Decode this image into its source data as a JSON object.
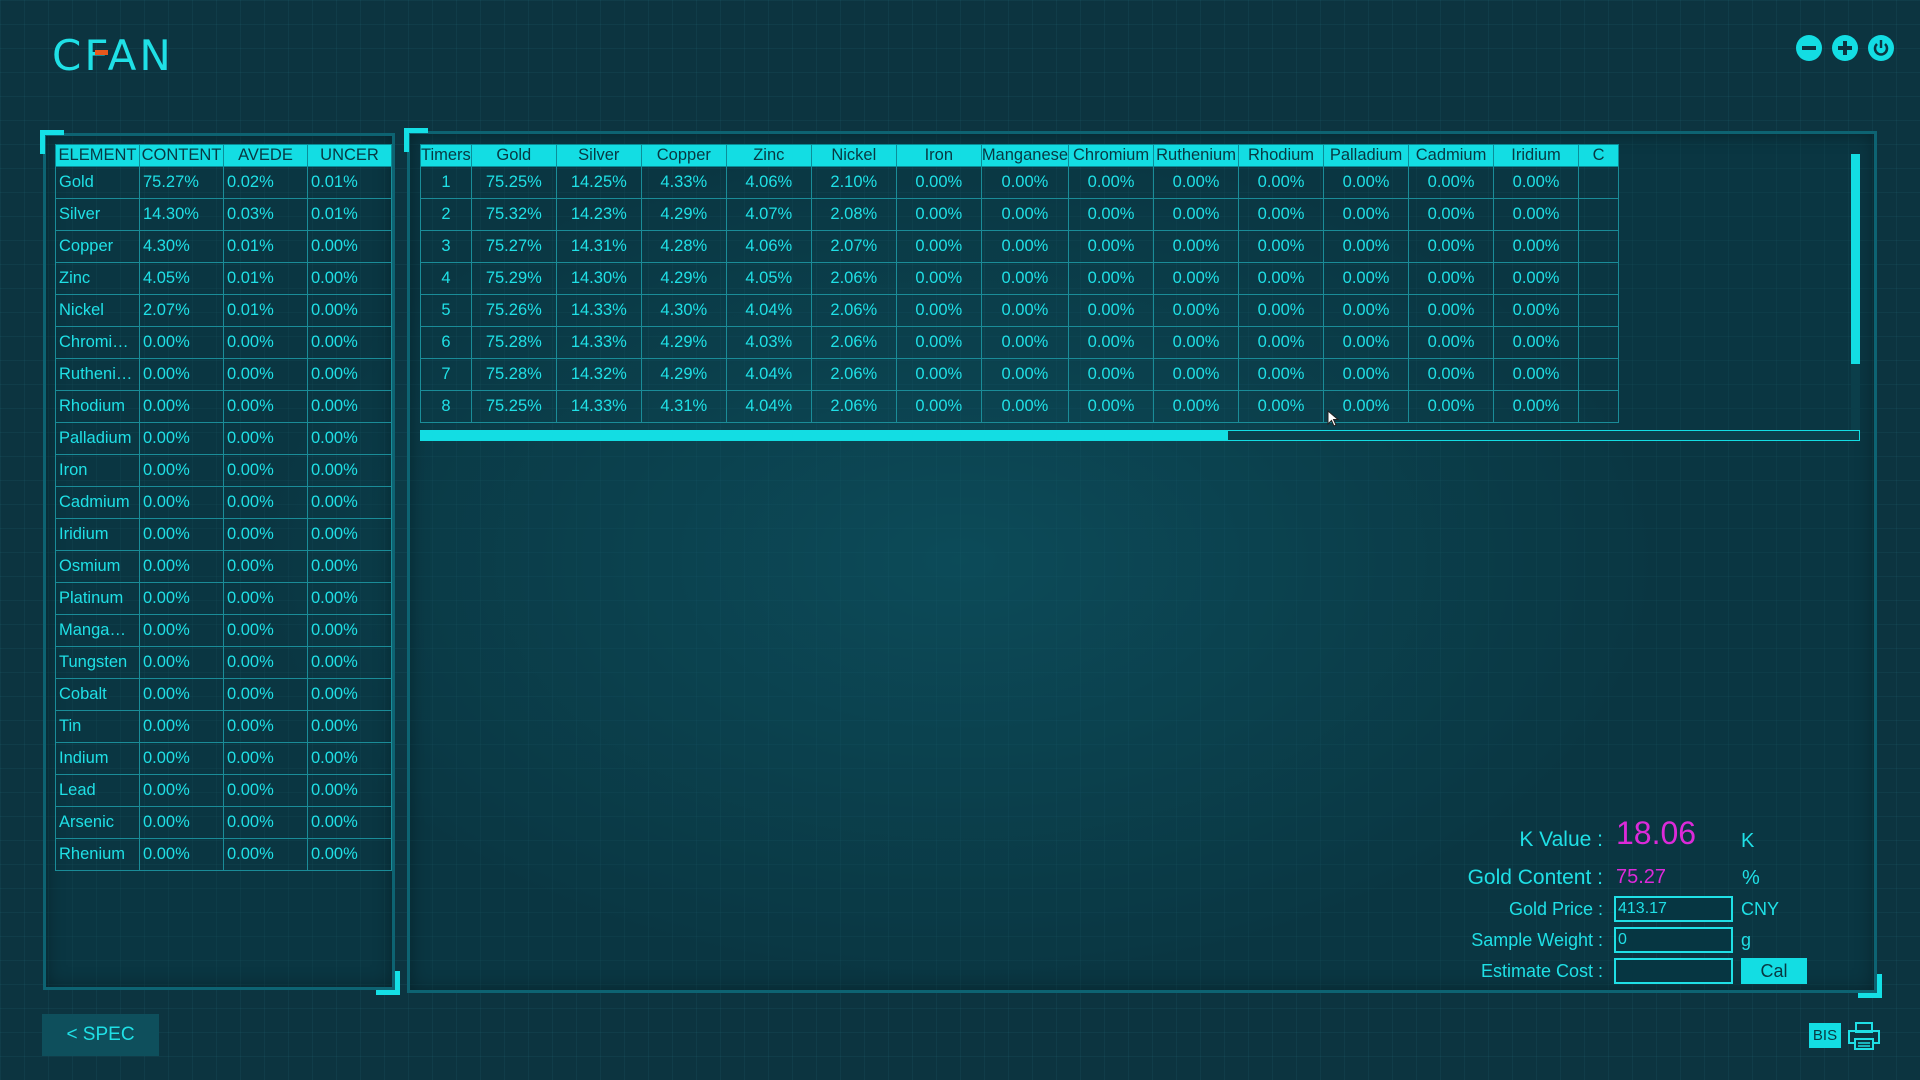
{
  "app": {
    "logo_text": "CFAN"
  },
  "window_controls": [
    "minimize-icon",
    "plus-icon",
    "power-icon"
  ],
  "element_table": {
    "headers": [
      "ELEMENT",
      "CONTENT",
      "AVEDE",
      "UNCER"
    ],
    "rows": [
      [
        "Gold",
        "75.27%",
        "0.02%",
        "0.01%"
      ],
      [
        "Silver",
        "14.30%",
        "0.03%",
        "0.01%"
      ],
      [
        "Copper",
        "4.30%",
        "0.01%",
        "0.00%"
      ],
      [
        "Zinc",
        "4.05%",
        "0.01%",
        "0.00%"
      ],
      [
        "Nickel",
        "2.07%",
        "0.01%",
        "0.00%"
      ],
      [
        "Chromi…",
        "0.00%",
        "0.00%",
        "0.00%"
      ],
      [
        "Rutheni…",
        "0.00%",
        "0.00%",
        "0.00%"
      ],
      [
        "Rhodium",
        "0.00%",
        "0.00%",
        "0.00%"
      ],
      [
        "Palladium",
        "0.00%",
        "0.00%",
        "0.00%"
      ],
      [
        "Iron",
        "0.00%",
        "0.00%",
        "0.00%"
      ],
      [
        "Cadmium",
        "0.00%",
        "0.00%",
        "0.00%"
      ],
      [
        "Iridium",
        "0.00%",
        "0.00%",
        "0.00%"
      ],
      [
        "Osmium",
        "0.00%",
        "0.00%",
        "0.00%"
      ],
      [
        "Platinum",
        "0.00%",
        "0.00%",
        "0.00%"
      ],
      [
        "Manga…",
        "0.00%",
        "0.00%",
        "0.00%"
      ],
      [
        "Tungsten",
        "0.00%",
        "0.00%",
        "0.00%"
      ],
      [
        "Cobalt",
        "0.00%",
        "0.00%",
        "0.00%"
      ],
      [
        "Tin",
        "0.00%",
        "0.00%",
        "0.00%"
      ],
      [
        "Indium",
        "0.00%",
        "0.00%",
        "0.00%"
      ],
      [
        "Lead",
        "0.00%",
        "0.00%",
        "0.00%"
      ],
      [
        "Arsenic",
        "0.00%",
        "0.00%",
        "0.00%"
      ],
      [
        "Rhenium",
        "0.00%",
        "0.00%",
        "0.00%"
      ]
    ]
  },
  "measurement_table": {
    "headers": [
      "Timers",
      "Gold",
      "Silver",
      "Copper",
      "Zinc",
      "Nickel",
      "Iron",
      "Manganese",
      "Chromium",
      "Ruthenium",
      "Rhodium",
      "Palladium",
      "Cadmium",
      "Iridium",
      "C"
    ],
    "rows": [
      [
        "1",
        "75.25%",
        "14.25%",
        "4.33%",
        "4.06%",
        "2.10%",
        "0.00%",
        "0.00%",
        "0.00%",
        "0.00%",
        "0.00%",
        "0.00%",
        "0.00%",
        "0.00%",
        ""
      ],
      [
        "2",
        "75.32%",
        "14.23%",
        "4.29%",
        "4.07%",
        "2.08%",
        "0.00%",
        "0.00%",
        "0.00%",
        "0.00%",
        "0.00%",
        "0.00%",
        "0.00%",
        "0.00%",
        ""
      ],
      [
        "3",
        "75.27%",
        "14.31%",
        "4.28%",
        "4.06%",
        "2.07%",
        "0.00%",
        "0.00%",
        "0.00%",
        "0.00%",
        "0.00%",
        "0.00%",
        "0.00%",
        "0.00%",
        ""
      ],
      [
        "4",
        "75.29%",
        "14.30%",
        "4.29%",
        "4.05%",
        "2.06%",
        "0.00%",
        "0.00%",
        "0.00%",
        "0.00%",
        "0.00%",
        "0.00%",
        "0.00%",
        "0.00%",
        ""
      ],
      [
        "5",
        "75.26%",
        "14.33%",
        "4.30%",
        "4.04%",
        "2.06%",
        "0.00%",
        "0.00%",
        "0.00%",
        "0.00%",
        "0.00%",
        "0.00%",
        "0.00%",
        "0.00%",
        ""
      ],
      [
        "6",
        "75.28%",
        "14.33%",
        "4.29%",
        "4.03%",
        "2.06%",
        "0.00%",
        "0.00%",
        "0.00%",
        "0.00%",
        "0.00%",
        "0.00%",
        "0.00%",
        "0.00%",
        ""
      ],
      [
        "7",
        "75.28%",
        "14.32%",
        "4.29%",
        "4.04%",
        "2.06%",
        "0.00%",
        "0.00%",
        "0.00%",
        "0.00%",
        "0.00%",
        "0.00%",
        "0.00%",
        "0.00%",
        ""
      ],
      [
        "8",
        "75.25%",
        "14.33%",
        "4.31%",
        "4.04%",
        "2.06%",
        "0.00%",
        "0.00%",
        "0.00%",
        "0.00%",
        "0.00%",
        "0.00%",
        "0.00%",
        "0.00%",
        ""
      ]
    ]
  },
  "results": {
    "k_value_label": "K Value :",
    "k_value": "18.06",
    "k_unit": "K",
    "gold_content_label": "Gold Content :",
    "gold_content": "75.27",
    "gold_content_unit": "%",
    "gold_price_label": "Gold Price :",
    "gold_price": "413.17",
    "gold_price_unit": "CNY",
    "sample_weight_label": "Sample Weight :",
    "sample_weight": "0",
    "sample_weight_unit": "g",
    "estimate_cost_label": "Estimate Cost :",
    "estimate_cost": "",
    "cal_label": "Cal"
  },
  "footer": {
    "spec_label": "< SPEC",
    "bis_label": "BIS"
  },
  "colors": {
    "accent": "#13dde3",
    "value": "#dc2ad9",
    "background": "#0c3440"
  }
}
